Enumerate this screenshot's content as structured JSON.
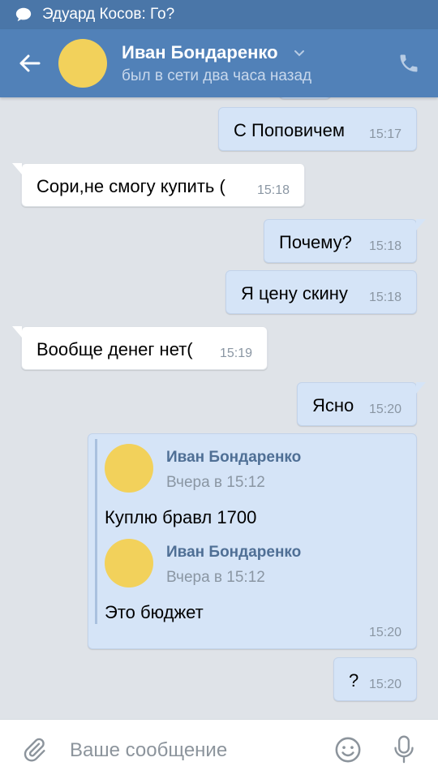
{
  "notification": {
    "icon": "chat-bubble-icon",
    "text": "Эдуард Косов: Го?"
  },
  "header": {
    "name": "Иван Бондаренко",
    "status": "был в сети два часа назад",
    "avatar_color": "#f2d15b",
    "bar_color": "#5181b8"
  },
  "messages": [
    {
      "dir": "out",
      "text": "С Поповичем",
      "time": "15:17"
    },
    {
      "dir": "in",
      "text": "Сори,не смогу купить (",
      "time": "15:18"
    },
    {
      "dir": "out",
      "text": "Почему?",
      "time": "15:18"
    },
    {
      "dir": "out",
      "text": "Я цену скину",
      "time": "15:18"
    },
    {
      "dir": "in",
      "text": "Вообще денег нет(",
      "time": "15:19"
    },
    {
      "dir": "out",
      "text": "Ясно",
      "time": "15:20"
    },
    {
      "dir": "out",
      "text": "?",
      "time": "15:20"
    }
  ],
  "forwarded": {
    "time": "15:20",
    "items": [
      {
        "name": "Иван Бондаренко",
        "date": "Вчера в 15:12",
        "text": "Куплю бравл 1700"
      },
      {
        "name": "Иван Бондаренко",
        "date": "Вчера в 15:12",
        "text": "Это бюджет"
      }
    ]
  },
  "input": {
    "placeholder": "Ваше сообщение"
  }
}
